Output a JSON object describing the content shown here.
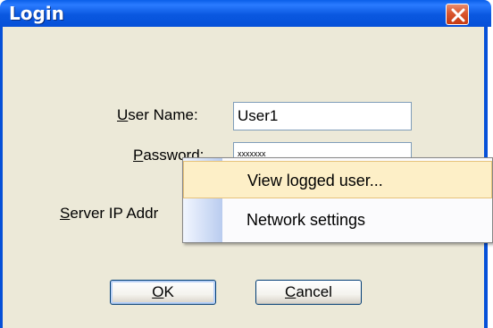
{
  "window": {
    "title": "Login"
  },
  "form": {
    "user_name": {
      "label_first": "U",
      "label_rest": "ser Name:",
      "value": "User1"
    },
    "password": {
      "label_first": "P",
      "label_rest": "assword:",
      "value": "xxxxxxx"
    },
    "server_ip": {
      "label_first": "S",
      "label_rest": "erver IP Addr"
    }
  },
  "buttons": {
    "ok": {
      "first": "O",
      "rest": "K"
    },
    "cancel": {
      "first": "C",
      "rest": "ancel"
    }
  },
  "context_menu": {
    "items": [
      {
        "label": "View logged user...",
        "highlighted": true
      },
      {
        "label": "Network settings",
        "highlighted": false
      }
    ]
  },
  "colors": {
    "titlebar": "#0a5ee8",
    "dialog_bg": "#ece9d8",
    "close_button": "#d9562e",
    "menu_highlight": "#fdefc7"
  }
}
